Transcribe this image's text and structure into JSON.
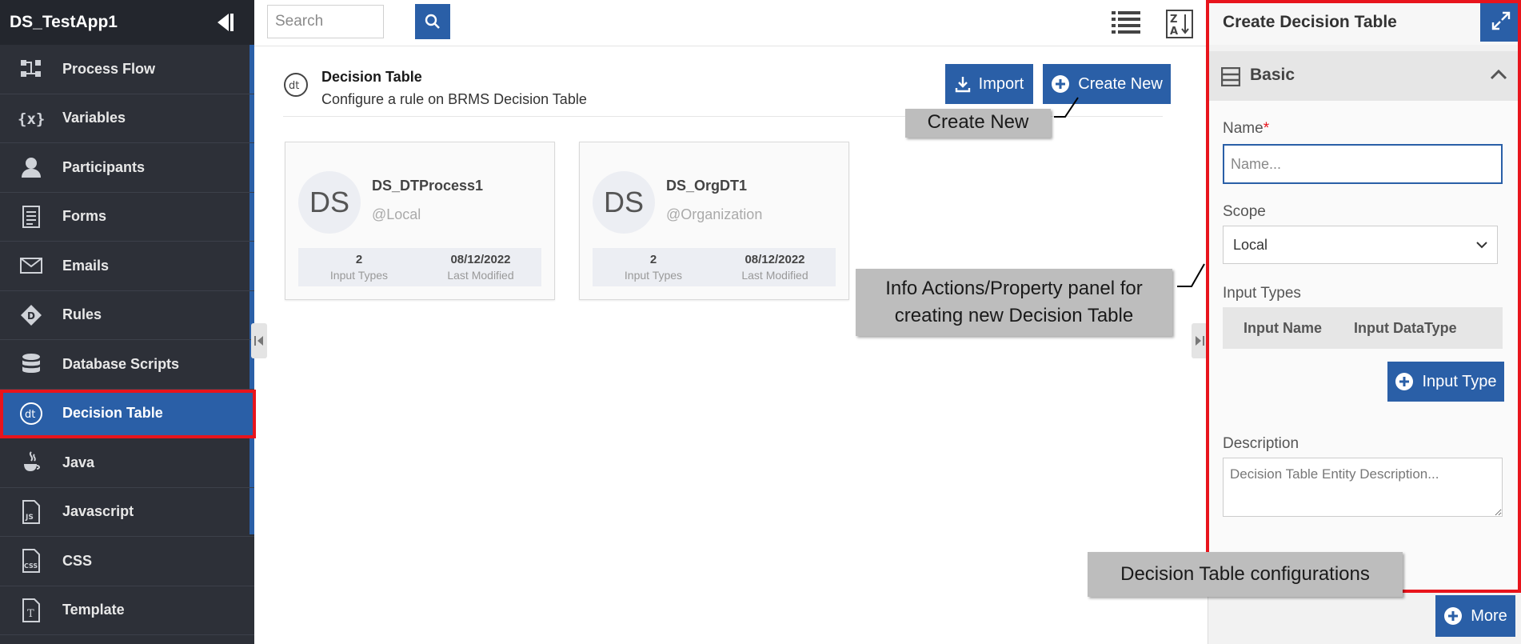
{
  "app": {
    "title": "DS_TestApp1"
  },
  "sidebar": {
    "items": [
      {
        "label": "Process Flow",
        "icon": "process-flow-icon"
      },
      {
        "label": "Variables",
        "icon": "variables-icon"
      },
      {
        "label": "Participants",
        "icon": "participants-icon"
      },
      {
        "label": "Forms",
        "icon": "forms-icon"
      },
      {
        "label": "Emails",
        "icon": "emails-icon"
      },
      {
        "label": "Rules",
        "icon": "rules-icon"
      },
      {
        "label": "Database Scripts",
        "icon": "database-icon"
      },
      {
        "label": "Decision Table",
        "icon": "decision-table-icon",
        "active": true
      },
      {
        "label": "Java",
        "icon": "java-icon"
      },
      {
        "label": "Javascript",
        "icon": "javascript-icon"
      },
      {
        "label": "CSS",
        "icon": "css-icon"
      },
      {
        "label": "Template",
        "icon": "template-icon"
      }
    ]
  },
  "toolbar": {
    "search_placeholder": "Search"
  },
  "main": {
    "title": "Decision Table",
    "subtitle": "Configure a rule on BRMS Decision Table",
    "icon_text": "dt",
    "import_label": "Import",
    "create_label": "Create New"
  },
  "cards": [
    {
      "avatar": "DS",
      "name": "DS_DTProcess1",
      "scope": "@Local",
      "input_types": "2",
      "input_types_label": "Input Types",
      "modified": "08/12/2022",
      "modified_label": "Last Modified"
    },
    {
      "avatar": "DS",
      "name": "DS_OrgDT1",
      "scope": "@Organization",
      "input_types": "2",
      "input_types_label": "Input Types",
      "modified": "08/12/2022",
      "modified_label": "Last Modified"
    }
  ],
  "callouts": {
    "create_new": "Create New",
    "info_line1": "Info Actions/Property panel for",
    "info_line2": "creating new Decision Table",
    "configs": "Decision Table configurations"
  },
  "panel": {
    "title": "Create Decision Table",
    "section": "Basic",
    "name_label": "Name",
    "required_mark": "*",
    "name_placeholder": "Name...",
    "scope_label": "Scope",
    "scope_value": "Local",
    "input_types_label": "Input Types",
    "col_input_name": "Input Name",
    "col_input_datatype": "Input DataType",
    "input_type_button": "Input Type",
    "description_label": "Description",
    "description_placeholder": "Decision Table Entity Description...",
    "more_button": "More"
  },
  "colors": {
    "primary": "#2a5fa7",
    "sidebar": "#2d3038",
    "highlight": "#e8141c",
    "callout": "#bdbdbd"
  }
}
